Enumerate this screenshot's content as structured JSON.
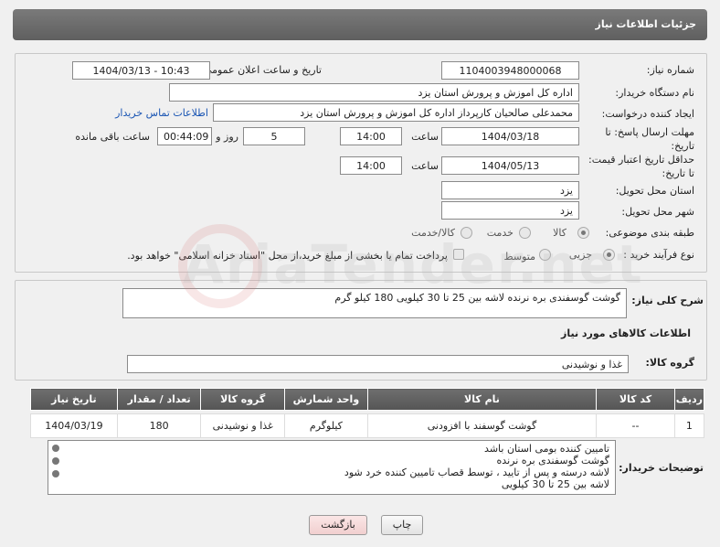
{
  "header": {
    "title": "جزئیات اطلاعات نیاز"
  },
  "fields": {
    "need_number_label": "شماره نیاز:",
    "need_number": "1104003948000068",
    "announce_label": "تاریخ و ساعت اعلان عمومی:",
    "announce_value": "1404/03/13 - 10:43",
    "buyer_org_label": "نام دستگاه خریدار:",
    "buyer_org": "اداره کل اموزش و پرورش استان یزد",
    "requester_label": "ایجاد کننده درخواست:",
    "requester": "محمدعلی صالحیان کارپرداز اداره کل اموزش و پرورش استان یزد",
    "contact_link": "اطلاعات تماس خریدار",
    "deadline_label": "مهلت ارسال پاسخ: تا تاریخ:",
    "deadline_date": "1404/03/18",
    "time_label": "ساعت",
    "deadline_time": "14:00",
    "days_value": "5",
    "days_label": "روز و",
    "remaining_time": "00:44:09",
    "remaining_label": "ساعت باقی مانده",
    "validity_label": "حداقل تاریخ اعتبار قیمت: تا تاریخ:",
    "validity_date": "1404/05/13",
    "validity_time": "14:00",
    "province_label": "استان محل تحویل:",
    "province": "یزد",
    "city_label": "شهر محل تحویل:",
    "city": "یزد",
    "category_label": "طبقه بندی موضوعی:",
    "category_options": [
      "کالا",
      "خدمت",
      "کالا/خدمت"
    ],
    "process_label": "نوع فرآیند خرید :",
    "process_options": [
      "جزیی",
      "متوسط"
    ],
    "payment_note": "پرداخت تمام یا بخشی از مبلغ خرید،از محل \"اسناد خزانه اسلامی\" خواهد بود."
  },
  "description": {
    "label": "شرح کلی نیاز:",
    "value": "گوشت گوسفندی بره نرنده لاشه بین 25 تا 30 کیلویی 180 کیلو گرم"
  },
  "goods": {
    "section_title": "اطلاعات کالاهای مورد نیاز",
    "group_label": "گروه کالا:",
    "group_value": "غذا و نوشیدنی",
    "columns": [
      "ردیف",
      "کد کالا",
      "نام کالا",
      "واحد شمارش",
      "گروه کالا",
      "تعداد / مقدار",
      "تاریخ نیاز"
    ],
    "rows": [
      [
        "1",
        "--",
        "گوشت گوسفند با افزودنی",
        "کیلوگرم",
        "غذا و نوشیدنی",
        "180",
        "1404/03/19"
      ]
    ]
  },
  "buyer_notes": {
    "label": "توضیحات خریدار:",
    "lines": [
      "تامیین کننده بومی استان باشد",
      "گوشت گوسفندی بره نرنده",
      "لاشه درسته و پس از تایید ، توسط قصاب تامیین کننده خرد شود",
      "لاشه بین 25 تا 30 کیلویی"
    ]
  },
  "buttons": {
    "print": "چاپ",
    "back": "بازگشت"
  },
  "watermark": "AriaTender.net",
  "colors": {
    "header": "#666666",
    "link": "#1a55b3",
    "back_button": "#f6d7d7"
  }
}
